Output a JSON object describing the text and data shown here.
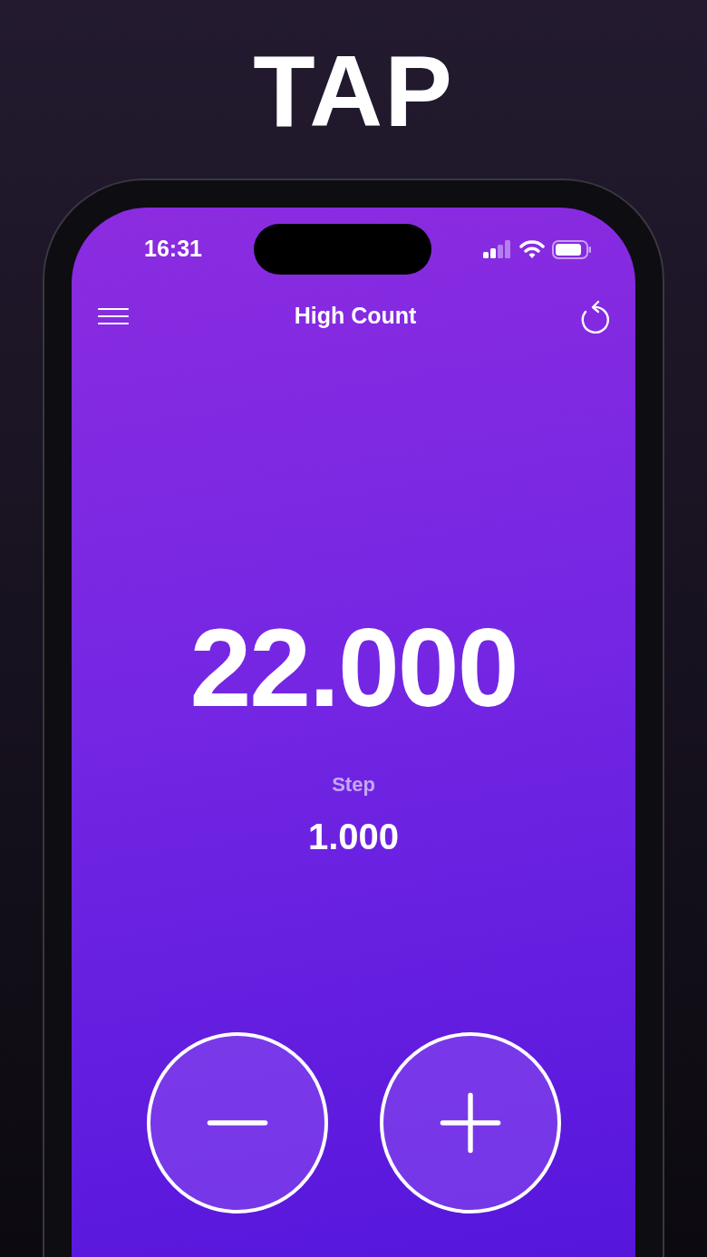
{
  "headline": "TAP",
  "status_bar": {
    "time": "16:31"
  },
  "header": {
    "title": "High Count"
  },
  "counter": {
    "value": "22.000",
    "step_label": "Step",
    "step_value": "1.000"
  },
  "buttons": [
    {
      "kind": "decrement"
    },
    {
      "kind": "increment"
    }
  ]
}
